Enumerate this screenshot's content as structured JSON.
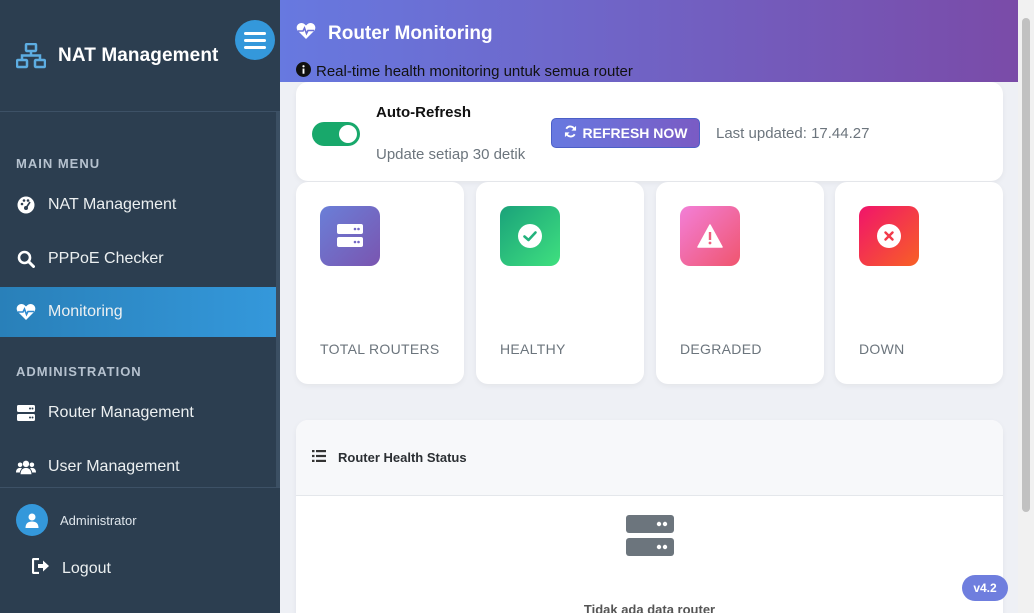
{
  "sidebar": {
    "brand_title": "NAT Management",
    "main_menu_title": "MAIN MENU",
    "admin_title": "ADMINISTRATION",
    "items": {
      "nat": "NAT Management",
      "pppoe": "PPPoE Checker",
      "monitoring": "Monitoring",
      "router": "Router Management",
      "user": "User Management"
    },
    "active_item": "Monitoring",
    "user_name": "Administrator",
    "logout_label": "Logout"
  },
  "header": {
    "title": "Router Monitoring",
    "subtitle": "Real-time health monitoring untuk semua router"
  },
  "refresh": {
    "title": "Auto-Refresh",
    "subtitle": "Update setiap 30 detik",
    "auto_refresh_on": true,
    "button_label": "REFRESH NOW",
    "last_updated": "Last updated: 17.44.27"
  },
  "stats": {
    "total_label": "TOTAL ROUTERS",
    "healthy_label": "HEALTHY",
    "degraded_label": "DEGRADED",
    "down_label": "DOWN"
  },
  "health": {
    "title": "Router Health Status",
    "empty_text": "Tidak ada data router"
  },
  "version": "v4.2",
  "colors": {
    "sidebar_bg": "#2c3e50",
    "accent": "#3498db",
    "header_start": "#6779e0",
    "header_end": "#7a4ba8",
    "toggle_on": "#18a86b"
  }
}
